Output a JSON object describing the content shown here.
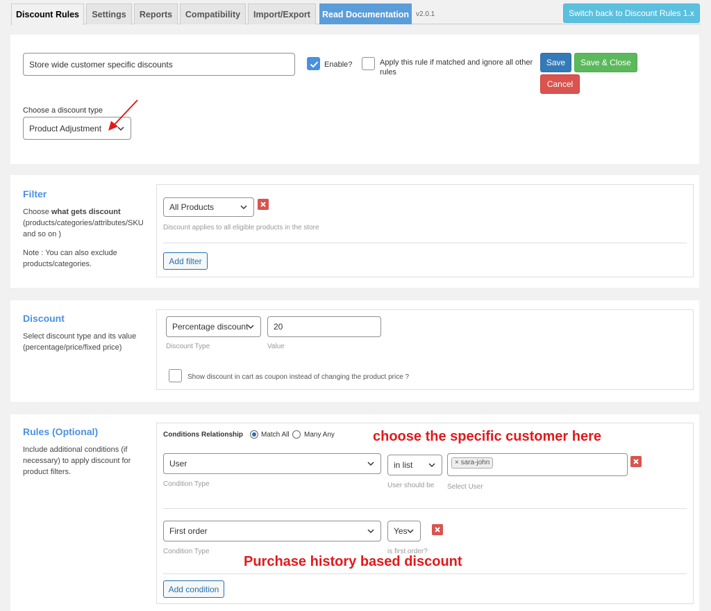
{
  "tabs": [
    {
      "label": "Discount Rules",
      "active": true
    },
    {
      "label": "Settings"
    },
    {
      "label": "Reports"
    },
    {
      "label": "Compatibility"
    },
    {
      "label": "Import/Export"
    },
    {
      "label": "Read Documentation"
    }
  ],
  "version": "v2.0.1",
  "switch_button": "Switch back to Discount Rules 1.x",
  "rule_editor": {
    "name_value": "Store wide customer specific discounts",
    "enable_label": "Enable?",
    "enable_checked": true,
    "apply_label_line1": "Apply this rule if matched and ignore all other",
    "apply_label_line2": "rules",
    "apply_checked": false,
    "save_label": "Save",
    "save_close_label": "Save & Close",
    "cancel_label": "Cancel",
    "discount_type_label": "Choose a discount type",
    "discount_type_value": "Product Adjustment"
  },
  "filter": {
    "title": "Filter",
    "desc_prefix": "Choose ",
    "desc_bold": "what gets discount",
    "desc_line2": "(products/categories/attributes/SKU",
    "desc_line3": "and so on )",
    "note_line1": "Note : You can also exclude",
    "note_line2": "products/categories.",
    "select_value": "All Products",
    "hint": "Discount applies to all eligible products in the store",
    "add_filter_label": "Add filter"
  },
  "discount": {
    "title": "Discount",
    "desc_line1": "Select discount type and its value",
    "desc_line2": "(percentage/price/fixed price)",
    "type_value": "Percentage discount",
    "type_label": "Discount Type",
    "value": "20",
    "value_label": "Value",
    "coupon_label": "Show discount in cart as coupon instead of changing the product price ?"
  },
  "rules": {
    "title": "Rules (Optional)",
    "desc_line1": "Include additional conditions (if",
    "desc_line2": "necessary) to apply discount for",
    "desc_line3": "product filters.",
    "relationship_label": "Conditions Relationship",
    "match_all_label": "Match All",
    "many_any_label": "Many Any",
    "condition1": {
      "type_value": "User",
      "type_label": "Condition Type",
      "operator_value": "in list",
      "operator_label": "User should be",
      "tag": "× sara-john",
      "select_label": "Select User"
    },
    "condition2": {
      "type_value": "First order",
      "type_label": "Condition Type",
      "operator_value": "Yes",
      "operator_label": "is first order?"
    },
    "add_condition_label": "Add condition"
  },
  "annotations": {
    "customer": "choose the specific customer here",
    "purchase": "Purchase history based discount"
  },
  "colors": {
    "accent": "#4a90e2",
    "annotation": "#e3191b",
    "save": "#337ab7",
    "save_close": "#5cb85c",
    "cancel": "#d9534f"
  }
}
